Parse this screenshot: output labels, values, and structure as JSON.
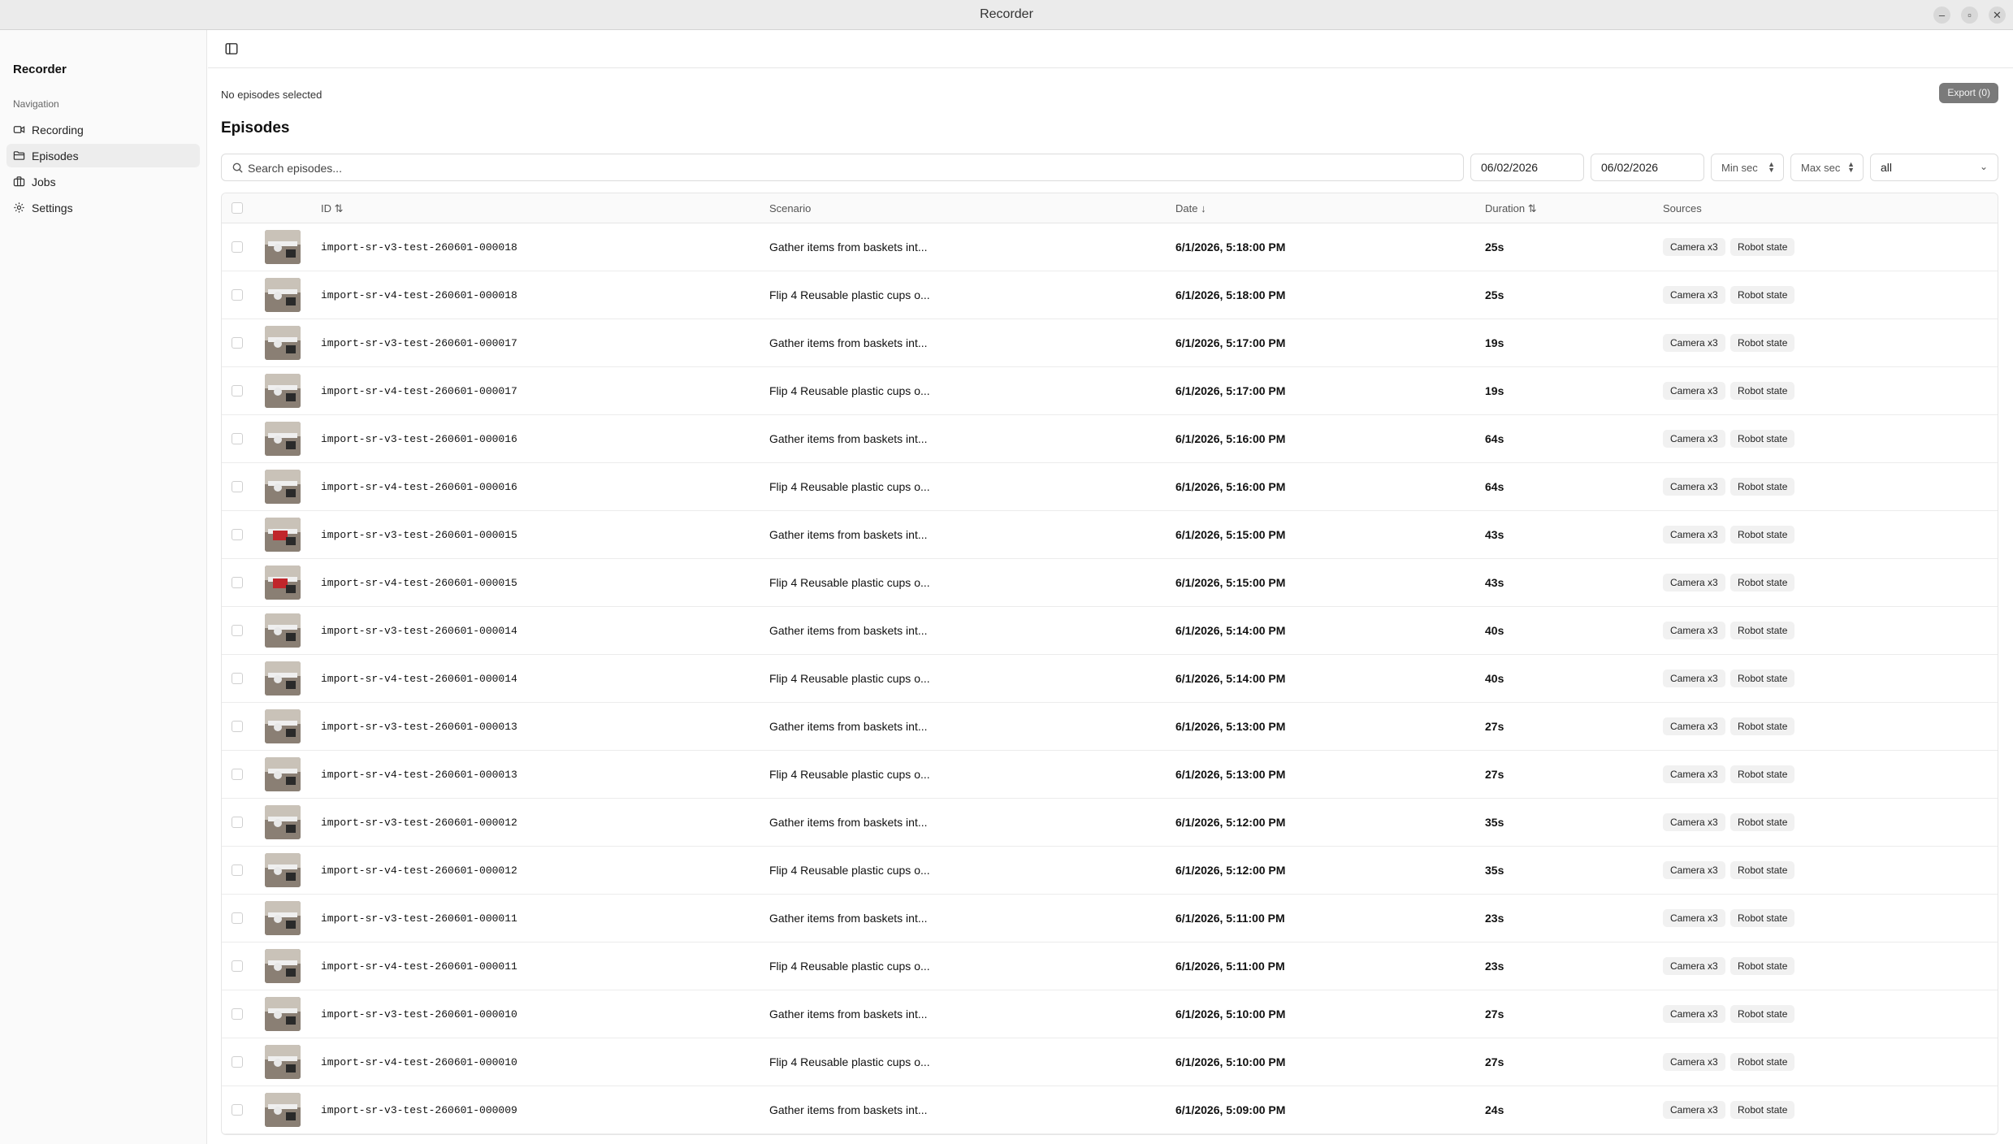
{
  "window": {
    "title": "Recorder"
  },
  "sidebar": {
    "brand": "Recorder",
    "nav_heading": "Navigation",
    "items": [
      {
        "label": "Recording",
        "icon": "video-icon"
      },
      {
        "label": "Episodes",
        "icon": "folder-icon",
        "active": true
      },
      {
        "label": "Jobs",
        "icon": "briefcase-icon"
      },
      {
        "label": "Settings",
        "icon": "gear-icon"
      }
    ]
  },
  "main": {
    "selection_text": "No episodes selected",
    "export_label": "Export (0)",
    "title": "Episodes"
  },
  "filters": {
    "search_placeholder": "Search episodes...",
    "date_from": "06/02/2026",
    "date_to": "06/02/2026",
    "min_sec_placeholder": "Min sec",
    "max_sec_placeholder": "Max sec",
    "status_select": "all"
  },
  "table": {
    "columns": {
      "id": "ID",
      "id_sort": "⇅",
      "scenario": "Scenario",
      "date": "Date",
      "date_sort": "↓",
      "duration": "Duration",
      "duration_sort": "⇅",
      "sources": "Sources"
    },
    "rows": [
      {
        "id": "import-sr-v3-test-260601-000018",
        "scenario": "Gather items from baskets int...",
        "date": "6/1/2026, 5:18:00 PM",
        "duration": "25s",
        "sources": [
          "Camera x3",
          "Robot state"
        ]
      },
      {
        "id": "import-sr-v4-test-260601-000018",
        "scenario": "Flip 4 Reusable plastic cups o...",
        "date": "6/1/2026, 5:18:00 PM",
        "duration": "25s",
        "sources": [
          "Camera x3",
          "Robot state"
        ]
      },
      {
        "id": "import-sr-v3-test-260601-000017",
        "scenario": "Gather items from baskets int...",
        "date": "6/1/2026, 5:17:00 PM",
        "duration": "19s",
        "sources": [
          "Camera x3",
          "Robot state"
        ]
      },
      {
        "id": "import-sr-v4-test-260601-000017",
        "scenario": "Flip 4 Reusable plastic cups o...",
        "date": "6/1/2026, 5:17:00 PM",
        "duration": "19s",
        "sources": [
          "Camera x3",
          "Robot state"
        ]
      },
      {
        "id": "import-sr-v3-test-260601-000016",
        "scenario": "Gather items from baskets int...",
        "date": "6/1/2026, 5:16:00 PM",
        "duration": "64s",
        "sources": [
          "Camera x3",
          "Robot state"
        ]
      },
      {
        "id": "import-sr-v4-test-260601-000016",
        "scenario": "Flip 4 Reusable plastic cups o...",
        "date": "6/1/2026, 5:16:00 PM",
        "duration": "64s",
        "sources": [
          "Camera x3",
          "Robot state"
        ]
      },
      {
        "id": "import-sr-v3-test-260601-000015",
        "scenario": "Gather items from baskets int...",
        "date": "6/1/2026, 5:15:00 PM",
        "duration": "43s",
        "sources": [
          "Camera x3",
          "Robot state"
        ]
      },
      {
        "id": "import-sr-v4-test-260601-000015",
        "scenario": "Flip 4 Reusable plastic cups o...",
        "date": "6/1/2026, 5:15:00 PM",
        "duration": "43s",
        "sources": [
          "Camera x3",
          "Robot state"
        ]
      },
      {
        "id": "import-sr-v3-test-260601-000014",
        "scenario": "Gather items from baskets int...",
        "date": "6/1/2026, 5:14:00 PM",
        "duration": "40s",
        "sources": [
          "Camera x3",
          "Robot state"
        ]
      },
      {
        "id": "import-sr-v4-test-260601-000014",
        "scenario": "Flip 4 Reusable plastic cups o...",
        "date": "6/1/2026, 5:14:00 PM",
        "duration": "40s",
        "sources": [
          "Camera x3",
          "Robot state"
        ]
      },
      {
        "id": "import-sr-v3-test-260601-000013",
        "scenario": "Gather items from baskets int...",
        "date": "6/1/2026, 5:13:00 PM",
        "duration": "27s",
        "sources": [
          "Camera x3",
          "Robot state"
        ]
      },
      {
        "id": "import-sr-v4-test-260601-000013",
        "scenario": "Flip 4 Reusable plastic cups o...",
        "date": "6/1/2026, 5:13:00 PM",
        "duration": "27s",
        "sources": [
          "Camera x3",
          "Robot state"
        ]
      },
      {
        "id": "import-sr-v3-test-260601-000012",
        "scenario": "Gather items from baskets int...",
        "date": "6/1/2026, 5:12:00 PM",
        "duration": "35s",
        "sources": [
          "Camera x3",
          "Robot state"
        ]
      },
      {
        "id": "import-sr-v4-test-260601-000012",
        "scenario": "Flip 4 Reusable plastic cups o...",
        "date": "6/1/2026, 5:12:00 PM",
        "duration": "35s",
        "sources": [
          "Camera x3",
          "Robot state"
        ]
      },
      {
        "id": "import-sr-v3-test-260601-000011",
        "scenario": "Gather items from baskets int...",
        "date": "6/1/2026, 5:11:00 PM",
        "duration": "23s",
        "sources": [
          "Camera x3",
          "Robot state"
        ]
      },
      {
        "id": "import-sr-v4-test-260601-000011",
        "scenario": "Flip 4 Reusable plastic cups o...",
        "date": "6/1/2026, 5:11:00 PM",
        "duration": "23s",
        "sources": [
          "Camera x3",
          "Robot state"
        ]
      },
      {
        "id": "import-sr-v3-test-260601-000010",
        "scenario": "Gather items from baskets int...",
        "date": "6/1/2026, 5:10:00 PM",
        "duration": "27s",
        "sources": [
          "Camera x3",
          "Robot state"
        ]
      },
      {
        "id": "import-sr-v4-test-260601-000010",
        "scenario": "Flip 4 Reusable plastic cups o...",
        "date": "6/1/2026, 5:10:00 PM",
        "duration": "27s",
        "sources": [
          "Camera x3",
          "Robot state"
        ]
      },
      {
        "id": "import-sr-v3-test-260601-000009",
        "scenario": "Gather items from baskets int...",
        "date": "6/1/2026, 5:09:00 PM",
        "duration": "24s",
        "sources": [
          "Camera x3",
          "Robot state"
        ]
      }
    ]
  },
  "colors": {
    "accent_button": "#7a7a7a",
    "badge_bg": "#f1f1f1"
  }
}
